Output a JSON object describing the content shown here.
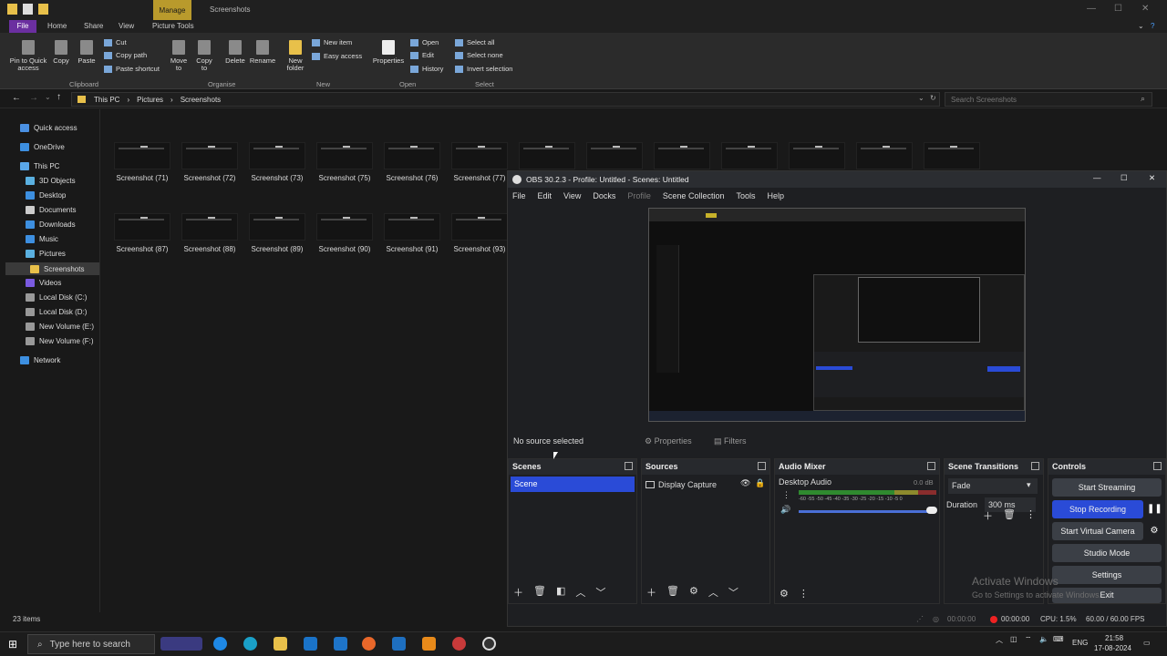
{
  "explorer": {
    "ribbon_context": "Manage",
    "window_title": "Screenshots",
    "tabs": [
      "File",
      "Home",
      "Share",
      "View",
      "Picture Tools"
    ],
    "buttons": {
      "pin": "Pin to Quick access",
      "copy": "Copy",
      "paste": "Paste",
      "cut": "Cut",
      "copy_path": "Copy path",
      "paste_shortcut": "Paste shortcut",
      "move_to": "Move to",
      "copy_to": "Copy to",
      "delete": "Delete",
      "rename": "Rename",
      "new_folder": "New folder",
      "new_item": "New item",
      "easy_access": "Easy access",
      "properties": "Properties",
      "open": "Open",
      "edit": "Edit",
      "history": "History",
      "select_all": "Select all",
      "select_none": "Select none",
      "invert_selection": "Invert selection"
    },
    "groups": [
      "Clipboard",
      "Organise",
      "New",
      "Open",
      "Select"
    ],
    "breadcrumb": [
      "This PC",
      "Pictures",
      "Screenshots"
    ],
    "search_placeholder": "Search Screenshots",
    "nav": [
      "Quick access",
      "OneDrive",
      "This PC",
      "3D Objects",
      "Desktop",
      "Documents",
      "Downloads",
      "Music",
      "Pictures",
      "Screenshots",
      "Videos",
      "Local Disk (C:)",
      "Local Disk (D:)",
      "New Volume (E:)",
      "New Volume (F:)",
      "Network"
    ],
    "files_row1": [
      "Screenshot (71)",
      "Screenshot (72)",
      "Screenshot (73)",
      "Screenshot (75)",
      "Screenshot (76)",
      "Screenshot (77)"
    ],
    "files_row2": [
      "Screenshot (87)",
      "Screenshot (88)",
      "Screenshot (89)",
      "Screenshot (90)",
      "Screenshot (91)",
      "Screenshot (93)"
    ],
    "item_count": "23 items"
  },
  "obs": {
    "title": "OBS 30.2.3 - Profile: Untitled - Scenes: Untitled",
    "menu": [
      "File",
      "Edit",
      "View",
      "Docks",
      "Profile",
      "Scene Collection",
      "Tools",
      "Help"
    ],
    "no_source": "No source selected",
    "properties": "Properties",
    "filters": "Filters",
    "docks": {
      "scenes": "Scenes",
      "sources": "Sources",
      "mixer": "Audio Mixer",
      "transitions": "Scene Transitions",
      "controls": "Controls"
    },
    "scene": "Scene",
    "source": "Display Capture",
    "mixer": {
      "name": "Desktop Audio",
      "level": "0.0 dB",
      "ticks": "-60 -55 -50 -45 -40 -35 -30 -25 -20 -15 -10 -5 0"
    },
    "transition": "Fade",
    "duration_label": "Duration",
    "duration": "300 ms",
    "controls": [
      "Start Streaming",
      "Stop Recording",
      "Start Virtual Camera",
      "Studio Mode",
      "Settings",
      "Exit"
    ],
    "status": {
      "stream_time": "00:00:00",
      "rec_time": "00:00:00",
      "cpu": "CPU: 1.5%",
      "fps": "60.00 / 60.00 FPS"
    }
  },
  "watermark": {
    "line1": "Activate Windows",
    "line2": "Go to Settings to activate Windows."
  },
  "taskbar": {
    "search": "Type here to search",
    "lang": "ENG",
    "time": "21:58",
    "date": "17-08-2024"
  },
  "colors": {
    "accent": "#2a4bd7",
    "manage": "#b99a2c",
    "file_tab": "#6b2fa0"
  }
}
